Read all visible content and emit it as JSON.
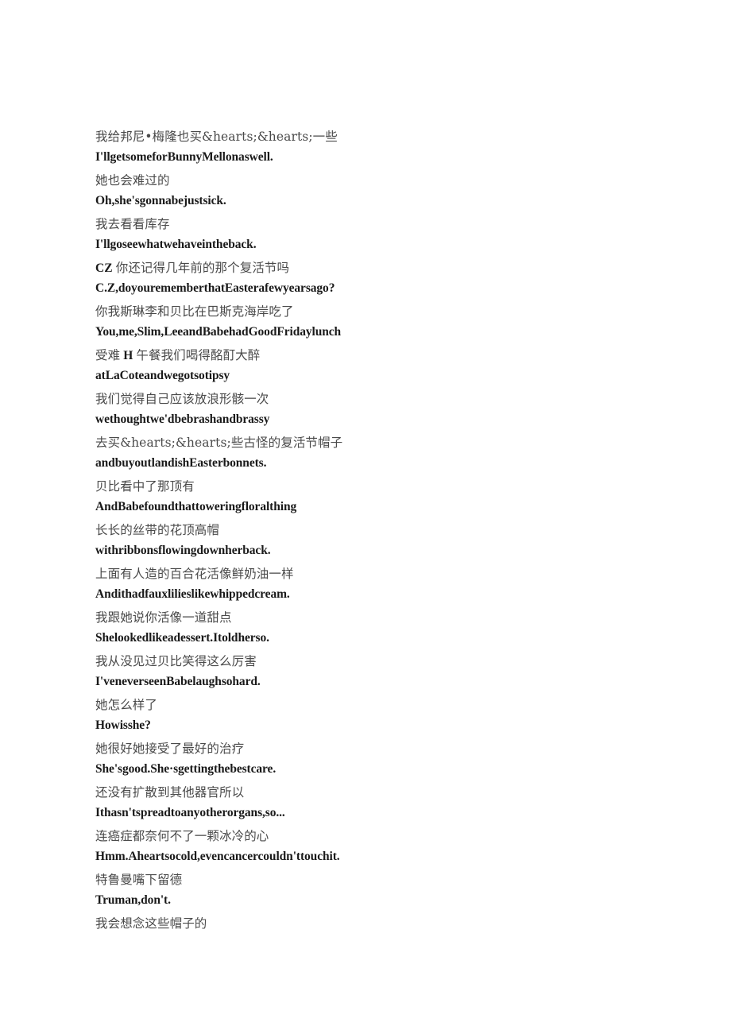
{
  "document": {
    "type": "bilingual-subtitle-transcript",
    "page_background": "#ffffff",
    "zh_color": "#4a4a4a",
    "en_color": "#1a1a1a"
  },
  "blocks": [
    {
      "zh": "我给邦尼•梅隆也买&hearts;&hearts;一些",
      "en": "I'llgetsomeforBunnyMellonaswell."
    },
    {
      "zh": "她也会难过的",
      "en": "Oh,she'sgonnabejustsick."
    },
    {
      "zh": "我去看看库存",
      "en": "I'llgoseewhatwehaveintheback."
    },
    {
      "zh_prefix": "CZ",
      "zh": "你还记得几年前的那个复活节吗",
      "en": "C.Z,doyourememberthatEasterafewyearsago?"
    },
    {
      "zh": "你我斯琳李和贝比在巴斯克海岸吃了",
      "en": "You,me,Slim,LeeandBabehadGoodFridaylunch"
    },
    {
      "zh_pre": "受难",
      "zh_token": "H",
      "zh_post": "午餐我们喝得酩酊大醉",
      "zh": "受难 H 午餐我们喝得酩酊大醉",
      "en": "atLaCoteandwegotsotipsy"
    },
    {
      "zh": "我们觉得自己应该放浪形骸一次",
      "en": "wethoughtwe'dbebrashandbrassy"
    },
    {
      "zh": "去买&hearts;&hearts;些古怪的复活节帽子",
      "en": "andbuyoutlandishEasterbonnets."
    },
    {
      "zh": "贝比看中了那顶有",
      "en": "AndBabefoundthattoweringfloralthing"
    },
    {
      "zh": "长长的丝带的花顶高帽",
      "en": "withribbonsflowingdownherback."
    },
    {
      "zh": "上面有人造的百合花活像鲜奶油一样",
      "en": "Andithadfauxlilieslikewhippedcream."
    },
    {
      "zh": "我跟她说你活像一道甜点",
      "en": "Shelookedlikeadessert.Itoldherso."
    },
    {
      "zh": "我从没见过贝比笑得这么厉害",
      "en": "I'veneverseenBabelaughsohard."
    },
    {
      "zh": "她怎么样了",
      "en": "Howisshe?"
    },
    {
      "zh": "她很好她接受了最好的治疗",
      "en": "She'sgood.She·sgettingthebestcare."
    },
    {
      "zh": "还没有扩散到其他器官所以",
      "en": "Ithasn'tspreadtoanyotherorgans,so..."
    },
    {
      "zh": "连癌症都奈何不了一颗冰冷的心",
      "en": "Hmm.Aheartsocold,evencancercouldn'ttouchit."
    },
    {
      "zh": "特鲁曼嘴下留德",
      "en": "Truman,don't."
    },
    {
      "zh": "我会想念这些帽子的",
      "en": ""
    }
  ]
}
